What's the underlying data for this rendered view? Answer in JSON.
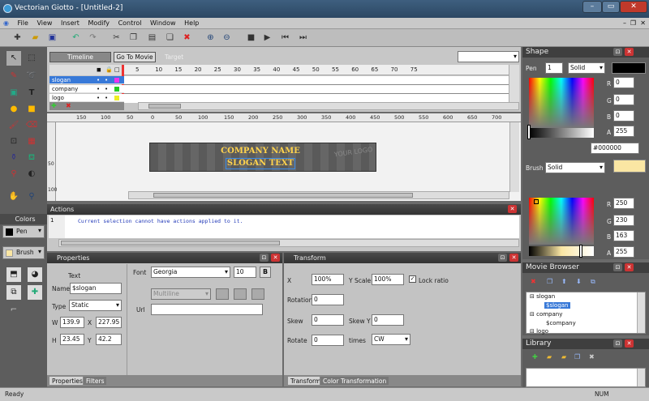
{
  "window": {
    "title": "Vectorian Giotto - [Untitled-2]",
    "min": "–",
    "max": "▭",
    "close": "✕"
  },
  "menu": [
    "File",
    "View",
    "Insert",
    "Modify",
    "Control",
    "Window",
    "Help"
  ],
  "timeline": {
    "tab_timeline": "Timeline",
    "tab_goto": "Go To Movie",
    "target_label": "Target",
    "ruler": [
      "5",
      "10",
      "15",
      "20",
      "25",
      "30",
      "35",
      "40",
      "45",
      "50",
      "55",
      "60",
      "65",
      "70",
      "75"
    ],
    "layers": [
      "slogan",
      "company",
      "logo"
    ]
  },
  "stage": {
    "ruler_h": [
      "150",
      "100",
      "50",
      "0",
      "50",
      "100",
      "150",
      "200",
      "250",
      "300",
      "350",
      "400",
      "450",
      "500",
      "550",
      "600",
      "650",
      "700"
    ],
    "ruler_v": [
      "50",
      "100"
    ],
    "company": "COMPANY NAME",
    "slogan": "SLOGAN TEXT",
    "logo": "YOUR LOGO"
  },
  "actions": {
    "title": "Actions",
    "line": "1",
    "message": "Current selection cannot have actions applied to it."
  },
  "properties": {
    "title": "Properties",
    "text_label": "Text",
    "name_label": "Name",
    "name_value": "$slogan",
    "type_label": "Type",
    "type_value": "Static",
    "w_label": "W",
    "w_value": "139.9",
    "x_label": "X",
    "x_value": "227.95",
    "h_label": "H",
    "h_value": "23.45",
    "y_label": "Y",
    "y_value": "42.2",
    "font_label": "Font",
    "font_value": "Georgia",
    "size_value": "10",
    "bold": "B",
    "multiline": "Multiline",
    "url_label": "Url",
    "tab_properties": "Properties",
    "tab_filters": "Filters"
  },
  "transform": {
    "title": "Transform",
    "x_label": "X",
    "x_value": "100%",
    "yscale_label": "Y Scale",
    "yscale_value": "100%",
    "lock_label": "Lock ratio",
    "rotation_label": "Rotation",
    "rotation_value": "0",
    "skew_label": "Skew",
    "skew_value": "0",
    "skewy_label": "Skew Y",
    "skewy_value": "0",
    "rotate_label": "Rotate",
    "rotate_value": "0",
    "times_label": "times",
    "times_value": "CW",
    "tab_transform": "Transform",
    "tab_color": "Color Transformation"
  },
  "shape": {
    "title": "Shape",
    "pen_label": "Pen",
    "pen_width": "1",
    "pen_style": "Solid",
    "r1": "0",
    "g1": "0",
    "b1": "0",
    "a1": "255",
    "hex": "#000000",
    "brush_label": "Brush",
    "brush_style": "Solid",
    "r2": "250",
    "g2": "230",
    "b2": "163",
    "a2": "255",
    "brush_color": "#fae6a3"
  },
  "movie_browser": {
    "title": "Movie Browser",
    "tree": [
      "slogan",
      "$slogan",
      "company",
      "$company",
      "logo"
    ]
  },
  "library": {
    "title": "Library"
  },
  "colors": {
    "title": "Colors",
    "pen": "Pen",
    "brush": "Brush"
  },
  "status": {
    "ready": "Ready",
    "num": "NUM"
  },
  "letters": {
    "R": "R",
    "G": "G",
    "B": "B",
    "A": "A"
  }
}
